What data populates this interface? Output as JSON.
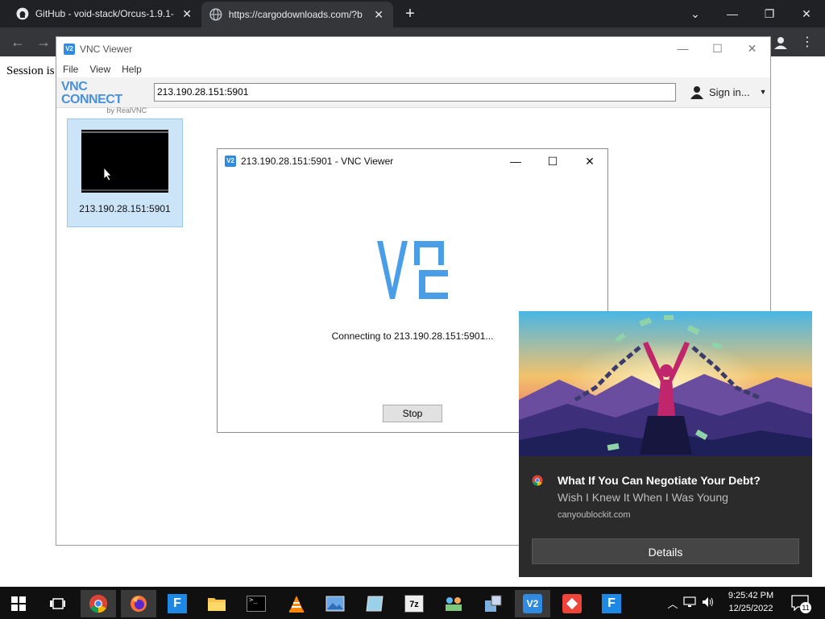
{
  "browser": {
    "tabs": [
      {
        "title": "GitHub - void-stack/Orcus-1.9.1-",
        "icon": "github-icon"
      },
      {
        "title": "https://cargodownloads.com/?b",
        "icon": "globe-icon"
      }
    ]
  },
  "page": {
    "partial_text": "Session is"
  },
  "vnc_main": {
    "title": "VNC Viewer",
    "menu": [
      "File",
      "View",
      "Help"
    ],
    "brand_top": "VNC CONNECT",
    "brand_bottom": "by RealVNC",
    "address_value": "213.190.28.151:5901",
    "signin_label": "Sign in...",
    "thumbnail_label": "213.190.28.151:5901"
  },
  "dialog": {
    "title": "213.190.28.151:5901 - VNC Viewer",
    "status": "Connecting to 213.190.28.151:5901...",
    "stop_label": "Stop"
  },
  "notification": {
    "title": "What If You Can Negotiate Your Debt?",
    "subtitle": "Wish I Knew It When I Was Young",
    "source": "canyoublockit.com",
    "button_label": "Details"
  },
  "taskbar": {
    "time": "9:25:42 PM",
    "date": "12/25/2022",
    "notification_count": "11"
  }
}
